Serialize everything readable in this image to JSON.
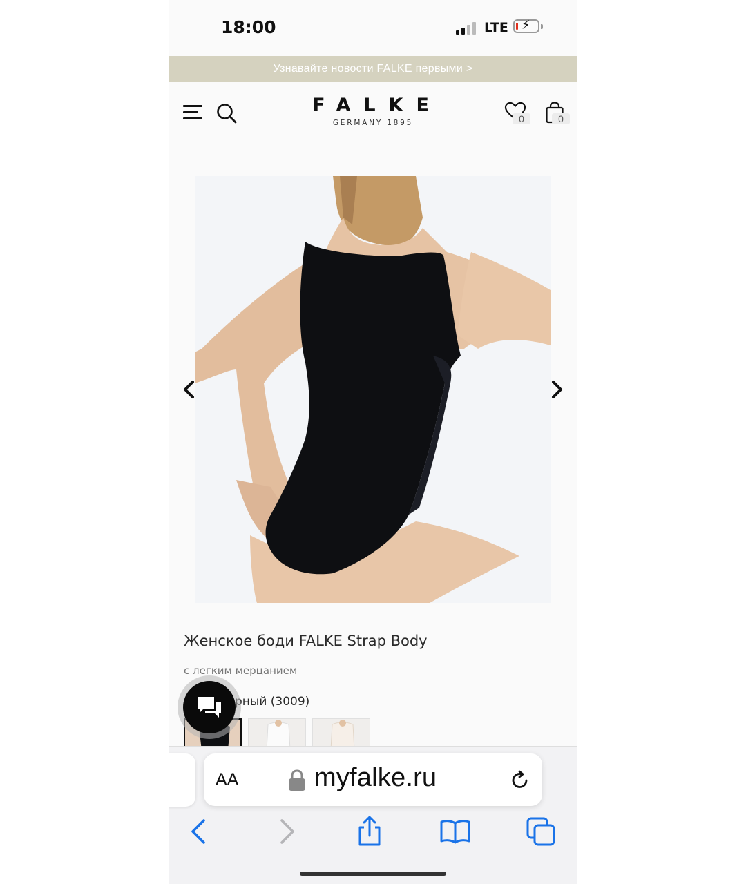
{
  "status_bar": {
    "time": "18:00",
    "network": "LTE"
  },
  "promo": {
    "text": "Узнавайте новости FALKE первыми >"
  },
  "header": {
    "logo": "FALKE",
    "logo_sub": "GERMANY 1895",
    "wishlist_count": "0",
    "cart_count": "0"
  },
  "product": {
    "title": "Женское боди FALKE Strap Body",
    "subtitle": "с легким мерцанием",
    "color_label": "рный (3009)",
    "swatch_count_note": "3"
  },
  "safari": {
    "text_size_label": "AA",
    "url": "myfalke.ru"
  },
  "colors": {
    "promo_bg": "#d5d2bf",
    "safari_blue": "#1a73e8",
    "body_black": "#0e0f12"
  }
}
